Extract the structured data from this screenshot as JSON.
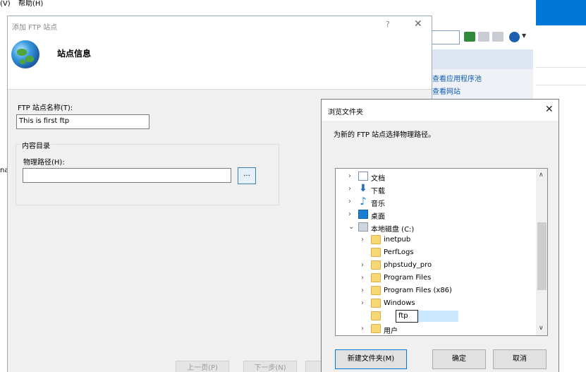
{
  "background_window": {
    "menu_left_fragment": "(V)",
    "menu_help": "帮助(H)",
    "action_links": [
      "查看应用程序池",
      "查看网站"
    ],
    "left_fragment": "na"
  },
  "add_ftp_dialog": {
    "title": "添加 FTP 站点",
    "help_glyph": "?",
    "close_glyph": "✕",
    "heading": "站点信息",
    "site_name_label": "FTP 站点名称(T):",
    "site_name_value": "This is first ftp",
    "content_group_label": "内容目录",
    "physical_path_label": "物理路径(H):",
    "physical_path_value": "",
    "browse_button": "...",
    "buttons": {
      "prev": "上一页(P)",
      "next": "下一步(N)"
    }
  },
  "browse_dialog": {
    "title": "浏览文件夹",
    "close_glyph": "✕",
    "description": "为新的 FTP 站点选择物理路径。",
    "tree": [
      {
        "label": "文档",
        "icon": "document-icon",
        "expander": "›",
        "indent": 0
      },
      {
        "label": "下载",
        "icon": "download-icon",
        "expander": "›",
        "indent": 0
      },
      {
        "label": "音乐",
        "icon": "music-icon",
        "expander": "›",
        "indent": 0
      },
      {
        "label": "桌面",
        "icon": "desktop-icon",
        "expander": "›",
        "indent": 0
      },
      {
        "label": "本地磁盘 (C:)",
        "icon": "drive-icon",
        "expander": "⌄",
        "indent": 0
      },
      {
        "label": "inetpub",
        "icon": "folder-icon",
        "expander": "›",
        "indent": 1
      },
      {
        "label": "PerfLogs",
        "icon": "folder-icon",
        "expander": "",
        "indent": 1
      },
      {
        "label": "phpstudy_pro",
        "icon": "folder-icon",
        "expander": "›",
        "indent": 1
      },
      {
        "label": "Program Files",
        "icon": "folder-icon",
        "expander": "›",
        "indent": 1
      },
      {
        "label": "Program Files (x86)",
        "icon": "folder-icon",
        "expander": "›",
        "indent": 1
      },
      {
        "label": "Windows",
        "icon": "folder-icon",
        "expander": "›",
        "indent": 1
      },
      {
        "label": "",
        "icon": "folder-icon",
        "expander": "",
        "indent": 1
      },
      {
        "label": "用户",
        "icon": "folder-icon",
        "expander": "›",
        "indent": 1
      }
    ],
    "new_folder_name": "ftp",
    "buttons": {
      "new_folder": "新建文件夹(M)",
      "ok": "确定",
      "cancel": "取消"
    }
  }
}
